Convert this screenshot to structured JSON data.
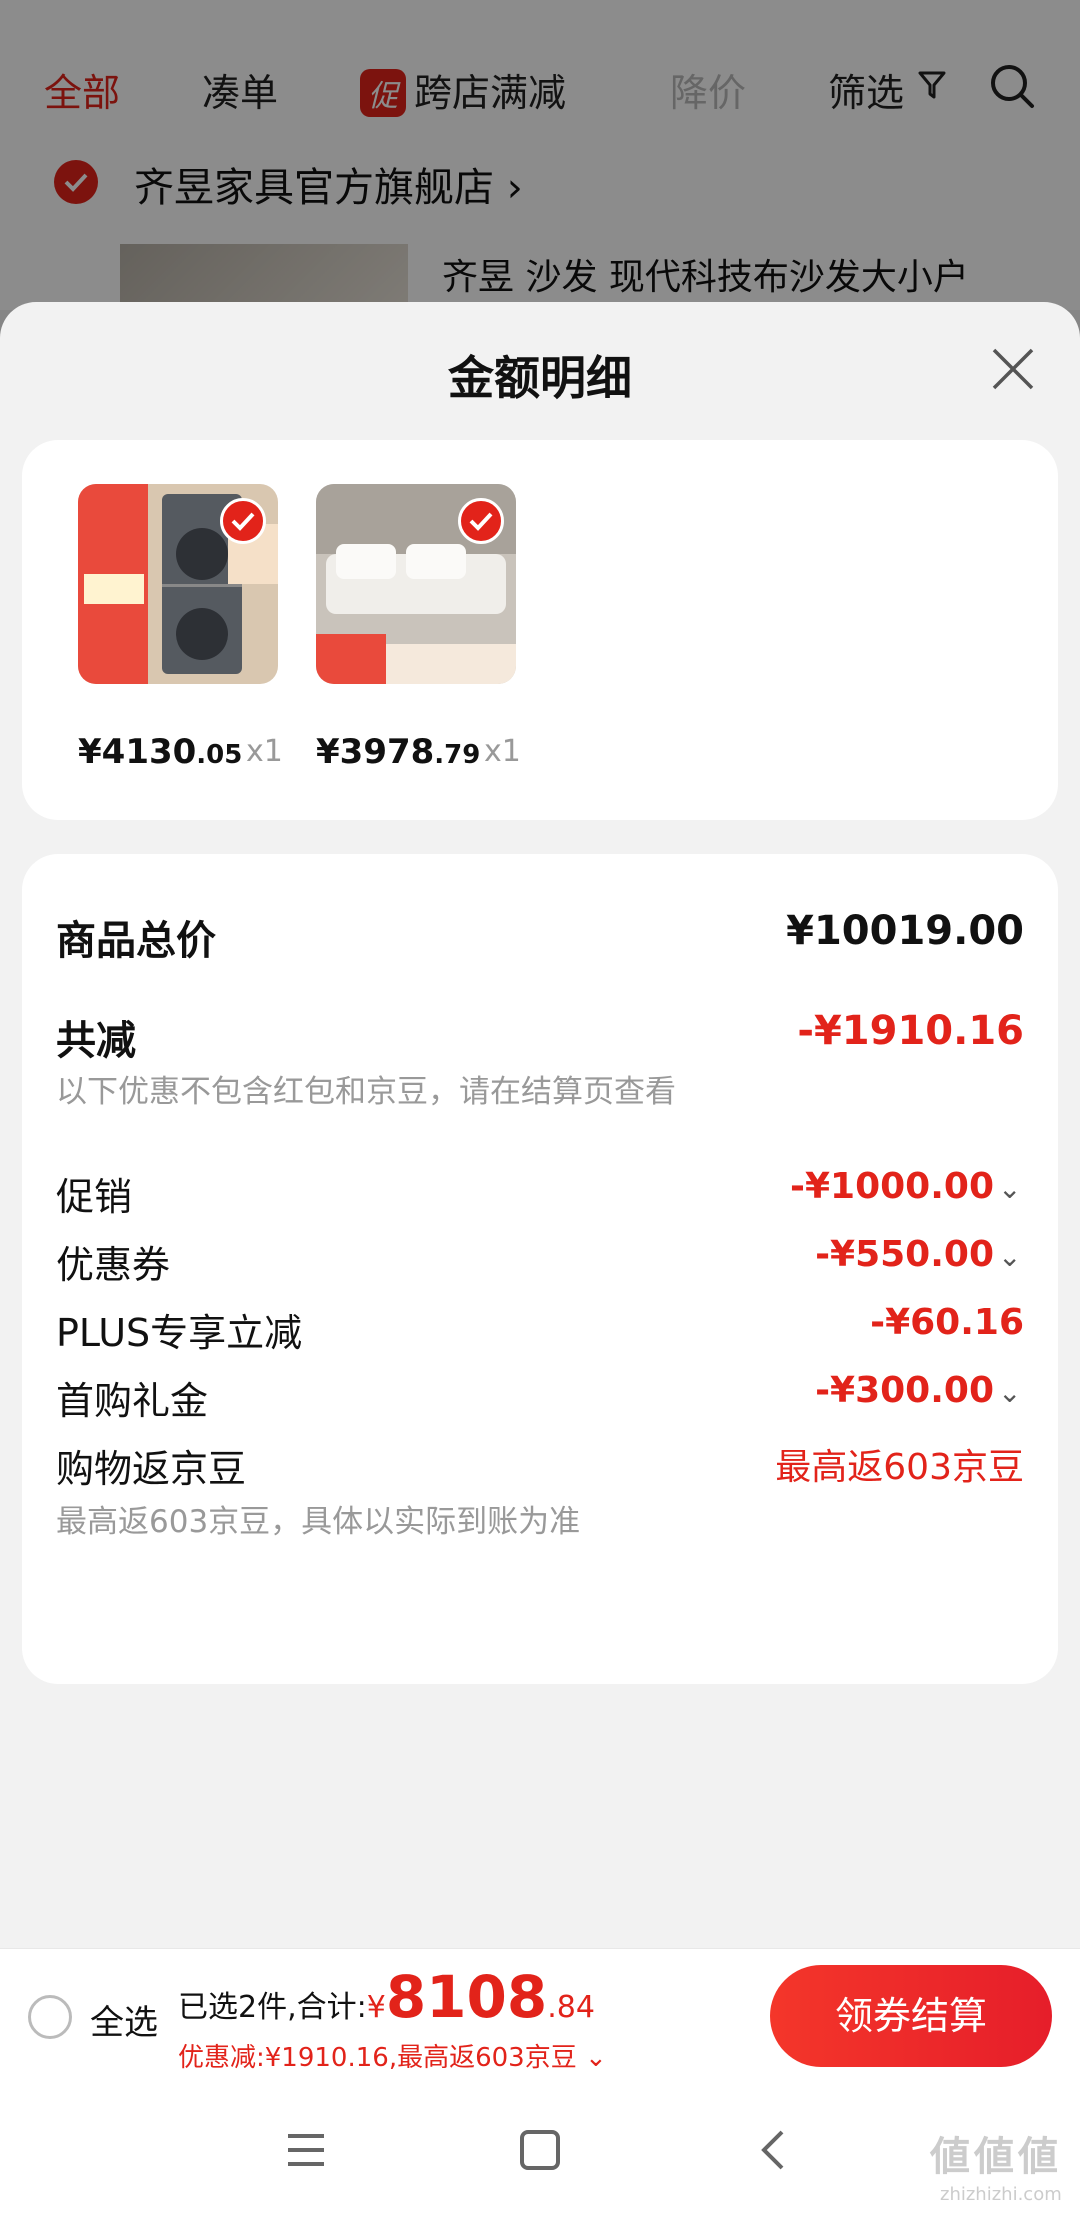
{
  "background": {
    "tabs": {
      "all": "全部",
      "bundle": "凑单",
      "promo_badge": "促",
      "cross_store": "跨店满减",
      "price_drop": "降价",
      "filter": "筛选"
    },
    "store": {
      "name": "齐昱家具官方旗舰店",
      "chevron": "›",
      "product_title": "齐昱 沙发 现代科技布沙发大小户"
    }
  },
  "sheet": {
    "title": "金额明细",
    "items": [
      {
        "price_int": "¥4130",
        "price_dec": ".05",
        "qty": "x1"
      },
      {
        "price_int": "¥3978",
        "price_dec": ".79",
        "qty": "x1"
      }
    ],
    "details": {
      "total_label": "商品总价",
      "total_value": "¥10019.00",
      "reduction_label": "共减",
      "reduction_value": "-¥1910.16",
      "reduction_note": "以下优惠不包含红包和京豆，请在结算页查看",
      "promo_label": "促销",
      "promo_value": "-¥1000.00",
      "coupon_label": "优惠券",
      "coupon_value": "-¥550.00",
      "plus_label": "PLUS专享立减",
      "plus_value": "-¥60.16",
      "first_buy_label": "首购礼金",
      "first_buy_value": "-¥300.00",
      "beans_label": "购物返京豆",
      "beans_value": "最高返603京豆",
      "beans_note": "最高返603京豆，具体以实际到账为准"
    }
  },
  "checkout": {
    "select_all": "全选",
    "selected_text": "已选2件,合计:",
    "currency": "¥",
    "total_int": "8108",
    "total_dec": ".84",
    "discount_text": "优惠减:¥1910.16,最高返603京豆",
    "button": "领券结算"
  },
  "watermark": {
    "text": "値値値",
    "sub": "zhizhizhi.com"
  },
  "colors": {
    "accent": "#e2231a",
    "background": "#f2f2f2"
  }
}
